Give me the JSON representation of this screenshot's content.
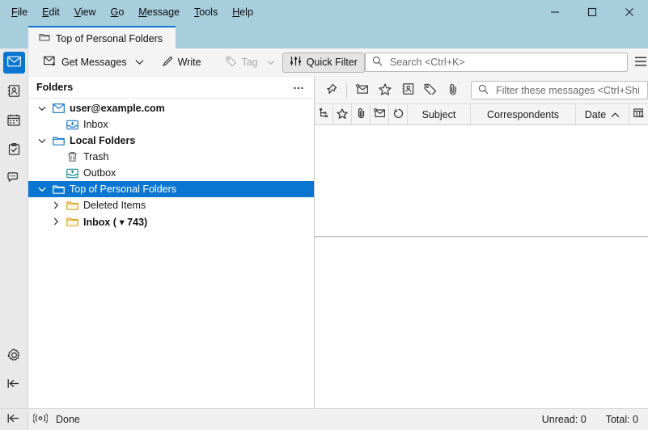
{
  "window": {
    "titlebar_color": "#a8cede",
    "controls": [
      {
        "name": "minimize",
        "glyph": "minimize-icon"
      },
      {
        "name": "maximize",
        "glyph": "maximize-icon"
      },
      {
        "name": "close",
        "glyph": "close-icon"
      }
    ]
  },
  "menubar": [
    {
      "label": "File",
      "mnemonic": "F"
    },
    {
      "label": "Edit",
      "mnemonic": "E"
    },
    {
      "label": "View",
      "mnemonic": "V"
    },
    {
      "label": "Go",
      "mnemonic": "G"
    },
    {
      "label": "Message",
      "mnemonic": "M"
    },
    {
      "label": "Tools",
      "mnemonic": "T"
    },
    {
      "label": "Help",
      "mnemonic": "H"
    }
  ],
  "tab": {
    "label": "Top of Personal Folders",
    "icon": "folder-icon",
    "accent": "#0a76d1"
  },
  "spaces": [
    {
      "name": "mail",
      "icon": "envelope-icon",
      "active": true
    },
    {
      "name": "address-book",
      "icon": "address-book-icon",
      "active": false
    },
    {
      "name": "calendar",
      "icon": "calendar-icon",
      "active": false
    },
    {
      "name": "tasks",
      "icon": "tasks-icon",
      "active": false
    },
    {
      "name": "chat",
      "icon": "chat-icon",
      "active": false
    }
  ],
  "spaces_bottom": [
    {
      "name": "settings",
      "icon": "gear-icon"
    },
    {
      "name": "collapse",
      "icon": "collapse-left-icon"
    }
  ],
  "toolbar": {
    "get_messages_label": "Get Messages",
    "get_messages_icon": "get-mail-icon",
    "get_messages_dropdown_icon": "chevron-down-icon",
    "write_label": "Write",
    "write_icon": "pencil-icon",
    "tag_label": "Tag",
    "tag_icon": "tag-icon",
    "tag_dropdown_icon": "chevron-down-icon",
    "tag_disabled": true,
    "quick_filter_label": "Quick Filter",
    "quick_filter_icon": "filter-sliders-icon",
    "quick_filter_pressed": true,
    "search_placeholder": "Search <Ctrl+K>",
    "search_value": "",
    "search_icon": "search-icon",
    "app_menu_icon": "hamburger-icon"
  },
  "folder_pane": {
    "header": "Folders",
    "more_label": "…",
    "items": [
      {
        "label": "user@example.com",
        "icon": "account-mail-icon",
        "indent": 0,
        "twisty": "down",
        "bold": true,
        "selected": false
      },
      {
        "label": "Inbox",
        "icon": "inbox-icon",
        "indent": 1,
        "twisty": "none",
        "bold": false,
        "selected": false
      },
      {
        "label": "Local Folders",
        "icon": "folder-blue-icon",
        "indent": 0,
        "twisty": "down",
        "bold": true,
        "selected": false
      },
      {
        "label": "Trash",
        "icon": "trash-icon",
        "indent": 1,
        "twisty": "none",
        "bold": false,
        "selected": false
      },
      {
        "label": "Outbox",
        "icon": "outbox-icon",
        "indent": 1,
        "twisty": "none",
        "bold": false,
        "selected": false
      },
      {
        "label": "Top of Personal Folders",
        "icon": "folder-blue-icon",
        "indent": 0,
        "twisty": "down",
        "bold": false,
        "selected": true
      },
      {
        "label": "Deleted Items",
        "icon": "folder-yellow-icon",
        "indent": 1,
        "twisty": "right",
        "bold": false,
        "selected": false
      },
      {
        "label": "Inbox ( ▾ 743)",
        "icon": "folder-yellow-icon",
        "indent": 1,
        "twisty": "right",
        "bold": true,
        "selected": false
      }
    ]
  },
  "quick_filter_bar": {
    "buttons": [
      {
        "name": "pin",
        "icon": "pin-icon"
      },
      {
        "name": "unread",
        "icon": "unread-envelope-icon"
      },
      {
        "name": "starred",
        "icon": "star-icon"
      },
      {
        "name": "contact",
        "icon": "address-book-icon"
      },
      {
        "name": "tags",
        "icon": "tag-icon"
      },
      {
        "name": "attachment",
        "icon": "paperclip-icon"
      }
    ],
    "filter_placeholder": "Filter these messages <Ctrl+Shift+K>",
    "filter_value": "",
    "filter_icon": "search-icon"
  },
  "message_list": {
    "columns": [
      {
        "name": "thread",
        "type": "icon",
        "icon": "thread-icon",
        "label": ""
      },
      {
        "name": "starred",
        "type": "icon",
        "icon": "star-icon",
        "label": ""
      },
      {
        "name": "attachment",
        "type": "icon",
        "icon": "paperclip-icon",
        "label": ""
      },
      {
        "name": "unread",
        "type": "icon",
        "icon": "unread-envelope-icon",
        "label": ""
      },
      {
        "name": "junk",
        "type": "icon",
        "icon": "junk-icon",
        "label": ""
      },
      {
        "name": "subject",
        "type": "text",
        "label": "Subject"
      },
      {
        "name": "correspondents",
        "type": "text",
        "label": "Correspondents"
      },
      {
        "name": "date",
        "type": "text",
        "label": "Date",
        "sort": "ascending",
        "sort_icon": "chevron-up-icon"
      },
      {
        "name": "column-picker",
        "type": "icon",
        "icon": "column-picker-icon",
        "label": ""
      }
    ],
    "rows": []
  },
  "statusbar": {
    "rail_icon": "collapse-left-icon",
    "connection_icon": "activity-icon",
    "text": "Done",
    "unread": "Unread: 0",
    "total": "Total: 0"
  }
}
